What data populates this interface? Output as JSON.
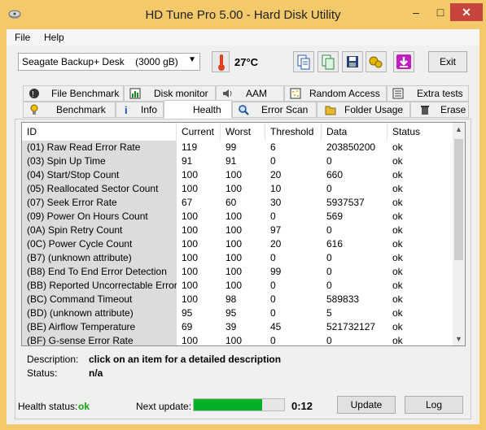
{
  "window": {
    "title": "HD Tune Pro 5.00 - Hard Disk Utility",
    "minimize": "–",
    "maximize": "□",
    "close": "✕"
  },
  "menu": {
    "file": "File",
    "help": "Help"
  },
  "toolbar": {
    "drive": "Seagate Backup+ Desk    (3000 gB)",
    "temperature": "27°C",
    "exit": "Exit",
    "icons": [
      "copy-text-icon",
      "copy-screenshot-icon",
      "save-icon",
      "options-icon",
      "download-icon"
    ]
  },
  "tabs": {
    "row1": [
      "File Benchmark",
      "Disk monitor",
      "AAM",
      "Random Access",
      "Extra tests"
    ],
    "row2": [
      "Benchmark",
      "Info",
      "Health",
      "Error Scan",
      "Folder Usage",
      "Erase"
    ],
    "active": "Health"
  },
  "table": {
    "headers": [
      "ID",
      "Current",
      "Worst",
      "Threshold",
      "Data",
      "Status"
    ],
    "rows": [
      [
        "(01) Raw Read Error Rate",
        "119",
        "99",
        "6",
        "203850200",
        "ok"
      ],
      [
        "(03) Spin Up Time",
        "91",
        "91",
        "0",
        "0",
        "ok"
      ],
      [
        "(04) Start/Stop Count",
        "100",
        "100",
        "20",
        "660",
        "ok"
      ],
      [
        "(05) Reallocated Sector Count",
        "100",
        "100",
        "10",
        "0",
        "ok"
      ],
      [
        "(07) Seek Error Rate",
        "67",
        "60",
        "30",
        "5937537",
        "ok"
      ],
      [
        "(09) Power On Hours Count",
        "100",
        "100",
        "0",
        "569",
        "ok"
      ],
      [
        "(0A) Spin Retry Count",
        "100",
        "100",
        "97",
        "0",
        "ok"
      ],
      [
        "(0C) Power Cycle Count",
        "100",
        "100",
        "20",
        "616",
        "ok"
      ],
      [
        "(B7) (unknown attribute)",
        "100",
        "100",
        "0",
        "0",
        "ok"
      ],
      [
        "(B8) End To End Error Detection",
        "100",
        "100",
        "99",
        "0",
        "ok"
      ],
      [
        "(BB) Reported Uncorrectable Errors",
        "100",
        "100",
        "0",
        "0",
        "ok"
      ],
      [
        "(BC) Command Timeout",
        "100",
        "98",
        "0",
        "589833",
        "ok"
      ],
      [
        "(BD) (unknown attribute)",
        "95",
        "95",
        "0",
        "5",
        "ok"
      ],
      [
        "(BE) Airflow Temperature",
        "69",
        "39",
        "45",
        "521732127",
        "ok"
      ],
      [
        "(BF) G-sense Error Rate",
        "100",
        "100",
        "0",
        "0",
        "ok"
      ]
    ]
  },
  "description": {
    "label": "Description:",
    "value": "click on an item for a detailed description"
  },
  "status": {
    "label": "Status:",
    "value": "n/a"
  },
  "footer": {
    "health_label": "Health status:",
    "health_value": "ok",
    "next_update_label": "Next update:",
    "next_update_progress": 0.76,
    "countdown": "0:12",
    "update": "Update",
    "log": "Log"
  },
  "colors": {
    "health_ok": "#13a10e",
    "progress": "#06b025",
    "close_button": "#c7453c"
  }
}
